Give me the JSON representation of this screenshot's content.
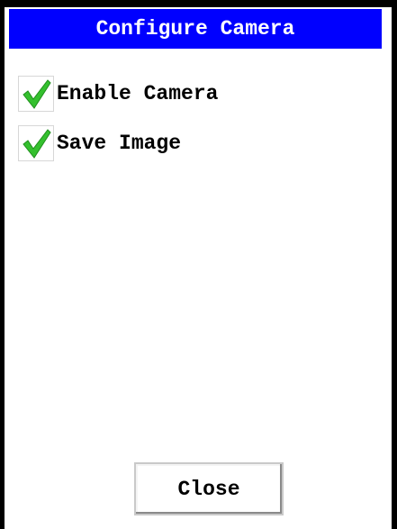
{
  "dialog": {
    "title": "Configure Camera",
    "title_bar_color": "#0000ff",
    "title_text_color": "#ffffff"
  },
  "options": [
    {
      "label": "Enable Camera",
      "checked": true,
      "icon": "checkmark-icon"
    },
    {
      "label": "Save Image",
      "checked": true,
      "icon": "checkmark-icon"
    }
  ],
  "actions": {
    "close_label": "Close"
  },
  "colors": {
    "check_green": "#34c02e",
    "frame": "#000000"
  }
}
